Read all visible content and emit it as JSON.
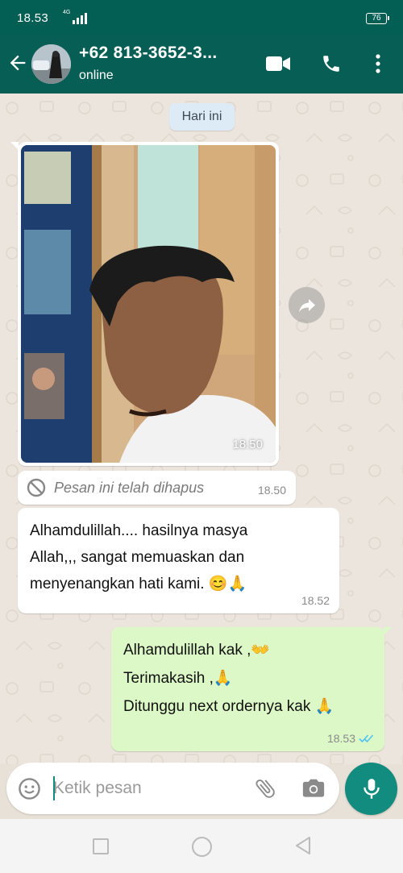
{
  "status_bar": {
    "time": "18.53",
    "network": "4G",
    "battery": "76"
  },
  "header": {
    "contact_name": "+62 813-3652-3...",
    "contact_status": "online",
    "icons": [
      "back-arrow-icon",
      "video-call-icon",
      "voice-call-icon",
      "more-vertical-icon"
    ]
  },
  "chat": {
    "date_chip": "Hari ini",
    "messages": [
      {
        "type": "image",
        "direction": "incoming",
        "time": "18.50"
      },
      {
        "type": "deleted",
        "direction": "incoming",
        "text": "Pesan ini telah dihapus",
        "time": "18.50"
      },
      {
        "type": "text",
        "direction": "incoming",
        "text": "Alhamdulillah.... hasilnya  masya\nAllah,,, sangat memuaskan dan\nmenyenangkan hati kami. 😊🙏",
        "time": "18.52"
      },
      {
        "type": "text",
        "direction": "outgoing",
        "text": "Alhamdulillah kak ,👐\nTerimakasih ,🙏\nDitunggu next ordernya kak 🙏",
        "time": "18.53",
        "status": "read"
      }
    ]
  },
  "composer": {
    "placeholder": "Ketik pesan",
    "value": "",
    "icons": [
      "emoji-icon",
      "attach-icon",
      "camera-icon",
      "mic-icon"
    ]
  },
  "colors": {
    "header": "#075e54",
    "status_bar": "#035e54",
    "outgoing_bubble": "#dcf8c6",
    "accent": "#128c7e",
    "read_ticks": "#4fc3f7"
  }
}
